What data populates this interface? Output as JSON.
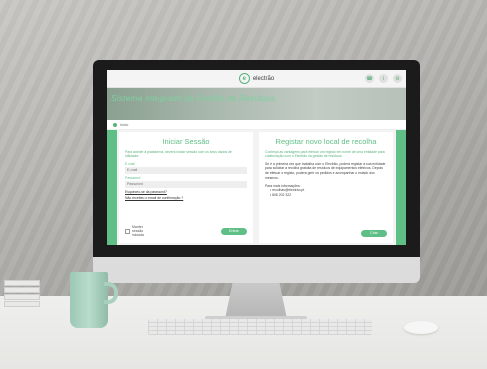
{
  "header": {
    "logo_text": "electrão",
    "icons": [
      "phone-icon",
      "info-icon",
      "settings-icon"
    ],
    "icon_glyphs": [
      "☎",
      "i",
      "⚙"
    ]
  },
  "hero": {
    "title": "Sistema Integrado de Gestão de Resíduos"
  },
  "breadcrumb": {
    "label": "Início"
  },
  "login": {
    "title": "Iniciar Sessão",
    "description": "Para aceder à plataforma, deverá iniciar sessão com os seus dados de utilizador.",
    "email_label": "E-mail",
    "email_placeholder": "E-mail",
    "password_label": "Password",
    "password_placeholder": "Password",
    "forgot_link": "Esqueceu-se da password?",
    "resend_link": "Não recebeu o email de confirmação ?",
    "remember_label": "Manter sessão iniciada",
    "submit_label": "Entrar"
  },
  "register": {
    "title": "Registar novo local de recolha",
    "subtitle": "Conheça as vantagens para efetuar um registo em nome de uma entidade para colaboração com o Electrão na gestão de resíduos.",
    "paragraph": "Se é a primeira vez que trabalha com o Electrão, poderá registar a sua entidade para solicitar a recolha gratuita de resíduos de equipamentos elétricos. Depois de efetuar o registo, poderá gerir os pedidos e acompanhar o estado dos mesmos.",
    "contacts_title": "Para mais informações:",
    "contacts": [
      "• recolhas@electrao.pt",
      "• 808 202 322"
    ],
    "button_label": "Criar"
  },
  "colors": {
    "accent": "#5fbf87",
    "hero_text": "#7fd1a0"
  }
}
